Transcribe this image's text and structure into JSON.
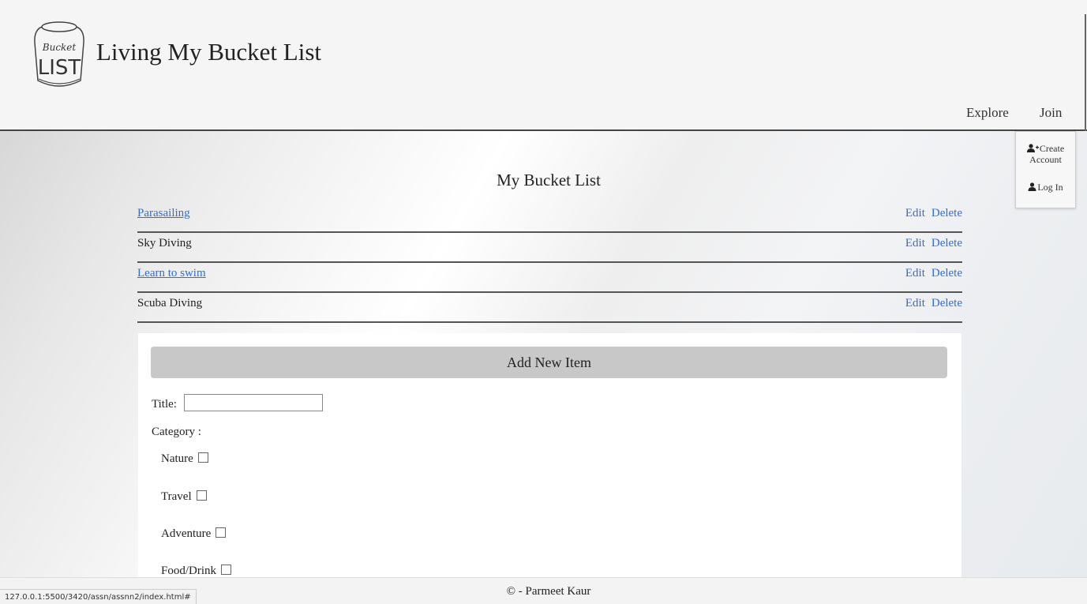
{
  "header": {
    "logo_text": [
      "Bucket",
      "LIST"
    ],
    "site_title": "Living My Bucket List",
    "nav": {
      "explore": "Explore",
      "join": "Join"
    }
  },
  "dropdown": {
    "create_line1": "Create",
    "create_line2": "Account",
    "login": "Log In",
    "icons": [
      "user-plus-icon",
      "user-icon"
    ]
  },
  "main": {
    "heading": "My Bucket List",
    "action_labels": {
      "edit": "Edit",
      "delete": "Delete"
    },
    "items": [
      {
        "title": "Parasailing",
        "link": true
      },
      {
        "title": "Sky Diving",
        "link": false
      },
      {
        "title": "Learn to swim",
        "link": true
      },
      {
        "title": "Scuba Diving",
        "link": false
      }
    ]
  },
  "form": {
    "add_label": "Add New Item",
    "title_label": "Title:",
    "title_value": "",
    "category_label": "Category :",
    "categories": [
      "Nature",
      "Travel",
      "Adventure",
      "Food/Drink"
    ]
  },
  "footer": {
    "text": "© - Parmeet Kaur"
  },
  "status_bar": {
    "url": "127.0.0.1:5500/3420/assn/assnn2/index.html#"
  },
  "colors": {
    "link": "#2f6fd2",
    "add_bar": "#c8c8c8",
    "divider": "#555555"
  }
}
